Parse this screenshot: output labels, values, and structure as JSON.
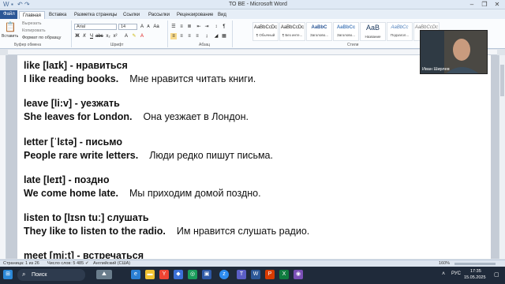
{
  "titlebar": {
    "title": "ТО BE - Microsoft Word"
  },
  "tabs": [
    "Файл",
    "Главная",
    "Вставка",
    "Разметка страницы",
    "Ссылки",
    "Рассылки",
    "Рецензирование",
    "Вид"
  ],
  "ribbon": {
    "paste_label": "Вставить",
    "cut_label": "Вырезать",
    "copy_label": "Копировать",
    "format_painter_label": "Формат по образцу",
    "clipboard_group": "Буфер обмена",
    "font_name": "Arial",
    "font_size": "14",
    "font_group": "Шрифт",
    "paragraph_group": "Абзац",
    "styles_group": "Стили",
    "styles": [
      {
        "sample": "AaBbCcDc",
        "name": "¶ Обычный"
      },
      {
        "sample": "AaBbCcDc",
        "name": "¶ Без инте..."
      },
      {
        "sample": "AaBbC",
        "name": "Заголово..."
      },
      {
        "sample": "AaBbCc",
        "name": "Заголово..."
      },
      {
        "sample": "AaB",
        "name": "Название"
      },
      {
        "sample": "AaBbCc",
        "name": "Подзагол..."
      },
      {
        "sample": "AaBbCcDc",
        "name": "Сла..."
      }
    ]
  },
  "document": {
    "lines": [
      {
        "term": "like [laɪk] - нравиться",
        "example": "I like reading books.",
        "translation": "Мне нравится читать книги."
      },
      {
        "term": "leave  [li:v] - уезжать",
        "example": "She leaves for London.",
        "translation": "Она уезжает в Лондон."
      },
      {
        "term": "letter  [ˈlɛtə] - письмо",
        "example": "People rare write letters.",
        "translation": "Люди редко пишут письма."
      },
      {
        "term": "late [leɪt] - поздно",
        "example": "We come home late.",
        "translation": "Мы приходим домой поздно."
      },
      {
        "term": "listen to [lɪsn tuː] слушать",
        "example": "They like to listen to the radio.",
        "translation": "Им нравится слушать радио."
      },
      {
        "term": "meet  [mi:t] - встречаться",
        "example": "",
        "translation": ""
      }
    ]
  },
  "status": {
    "page": "Страница: 1 из 26",
    "words": "Число слов: 5 485",
    "language": "Английский (США)",
    "zoom": "160%"
  },
  "webcam": {
    "name": "Иван Ширлев"
  },
  "taskbar": {
    "search_label": "Поиск",
    "lang": "РУС",
    "time": "17:35",
    "date": "15.05.2025"
  },
  "colors": {
    "accent": "#2b5797",
    "taskbar": "#1f2a3a"
  }
}
